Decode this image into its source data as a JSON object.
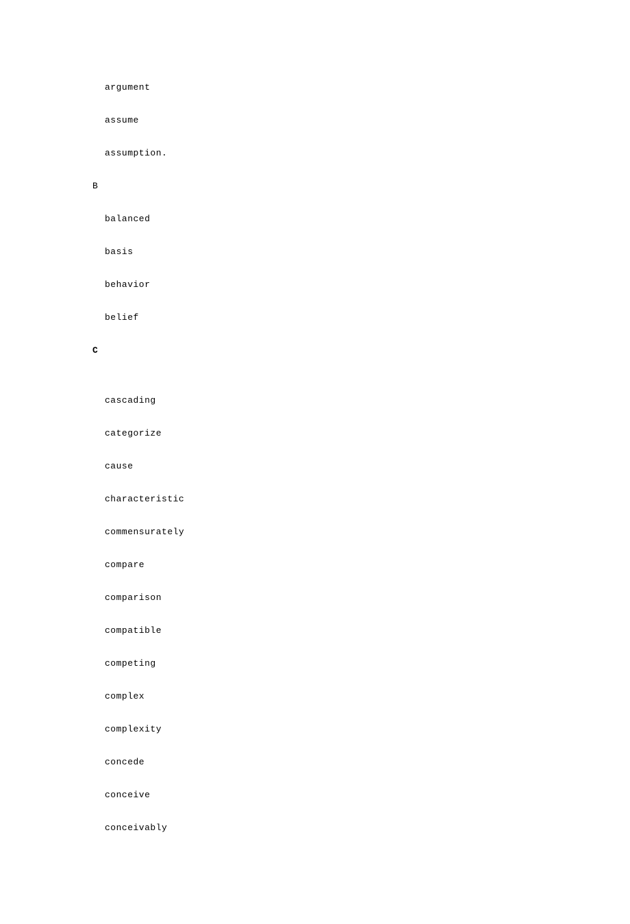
{
  "sections": [
    {
      "header": null,
      "terms": [
        "argument",
        "assume",
        "assumption."
      ]
    },
    {
      "header": "B",
      "bold": false,
      "extraGap": false,
      "terms": [
        "balanced",
        "basis",
        "behavior",
        "belief"
      ]
    },
    {
      "header": "C",
      "bold": true,
      "extraGap": true,
      "terms": [
        "cascading",
        "categorize",
        "cause",
        "characteristic",
        "commensurately",
        "compare",
        "comparison",
        "compatible",
        "competing",
        "complex",
        "complexity",
        "concede",
        "conceive",
        "conceivably"
      ]
    }
  ]
}
